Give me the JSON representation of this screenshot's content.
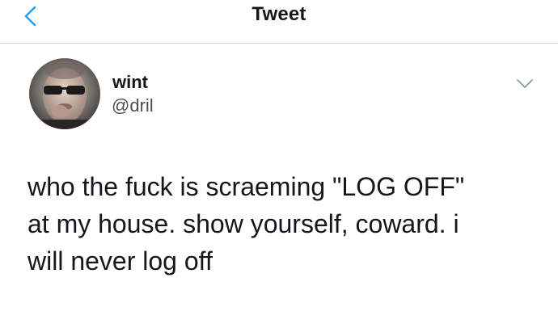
{
  "header": {
    "title": "Tweet",
    "back_icon": "chevron-left-icon",
    "accent_color": "#1da1f2"
  },
  "tweet": {
    "author": {
      "display_name": "wint",
      "handle": "@dril",
      "avatar_icon": "avatar-photo"
    },
    "menu_icon": "chevron-down-icon",
    "text_lines": [
      "who the fuck is scraeming \"LOG OFF\"",
      "at my house. show yourself, coward. i",
      "will never log off"
    ]
  }
}
